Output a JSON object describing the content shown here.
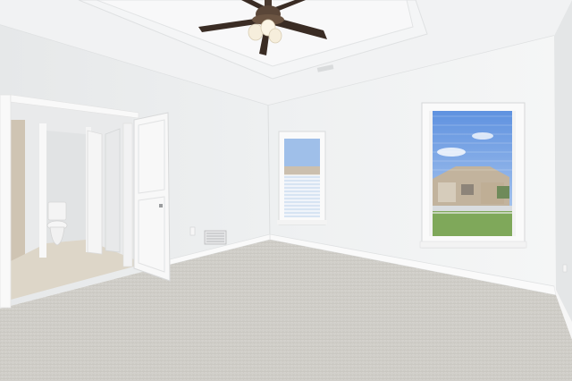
{
  "palette": {
    "ceiling": "#f1f2f3",
    "tray_inset": "#f7f7f8",
    "left_wall": "#eceeef",
    "back_wall": "#f3f4f5",
    "right_wall": "#e7e9ea",
    "trim": "#fbfbfb",
    "carpet": "#cfcdc8",
    "bath_floor": "#ddd6c8",
    "door": "#f7f7f7",
    "sky": "#7fa9e8",
    "lawn": "#7fa85a",
    "fan_blade": "#3a2c24",
    "fan_light": "#f6eedc"
  }
}
